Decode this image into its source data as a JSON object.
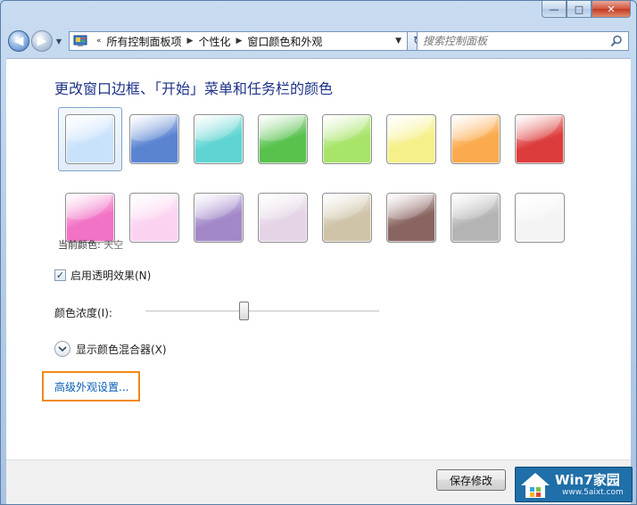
{
  "window": {
    "caption": {
      "minimize_glyph": "—",
      "maximize_glyph": "□",
      "close_glyph": "✕"
    }
  },
  "navbar": {
    "back_glyph": "◀",
    "forward_glyph": "▶",
    "history_glyph": "▼",
    "address": {
      "root_glyph": "«",
      "crumbs": [
        "所有控制面板项",
        "个性化",
        "窗口颜色和外观"
      ],
      "sep_glyph": "▶",
      "drop_glyph": "▼"
    },
    "refresh_glyph": "↻",
    "search_placeholder": "搜索控制面板"
  },
  "main": {
    "title": "更改窗口边框、「开始」菜单和任务栏的颜色",
    "swatches": [
      {
        "name": "sky",
        "color": "#c9e2fb",
        "selected": true
      },
      {
        "name": "twilight",
        "color": "#5a84d1",
        "selected": false
      },
      {
        "name": "sea",
        "color": "#5fd4d2",
        "selected": false
      },
      {
        "name": "leaf",
        "color": "#58c24d",
        "selected": false
      },
      {
        "name": "lime",
        "color": "#a8e46a",
        "selected": false
      },
      {
        "name": "lemon",
        "color": "#f6f08a",
        "selected": false
      },
      {
        "name": "pumpkin",
        "color": "#fbaa4d",
        "selected": false
      },
      {
        "name": "ruby",
        "color": "#dd3c3c",
        "selected": false
      },
      {
        "name": "fuchsia",
        "color": "#f272c6",
        "selected": false
      },
      {
        "name": "blush",
        "color": "#fbd3f1",
        "selected": false
      },
      {
        "name": "violet",
        "color": "#a288c9",
        "selected": false
      },
      {
        "name": "lavender",
        "color": "#e4d4e6",
        "selected": false
      },
      {
        "name": "taupe",
        "color": "#cfc3a8",
        "selected": false
      },
      {
        "name": "chocolate",
        "color": "#8a6460",
        "selected": false
      },
      {
        "name": "slate",
        "color": "#b4b4b4",
        "selected": false
      },
      {
        "name": "frost",
        "color": "#f4f4f4",
        "selected": false
      }
    ],
    "current_color_label": "当前颜色: ",
    "current_color_value": "天空",
    "transparency": {
      "label": "启用透明效果(N)",
      "checked": true,
      "check_glyph": "✓"
    },
    "intensity": {
      "label": "颜色浓度(I):",
      "level": 0.42
    },
    "mixer_label": "显示颜色混合器(X)",
    "advanced_link": "高级外观设置..."
  },
  "footer": {
    "save_label": "保存修改"
  },
  "watermark": {
    "title": "Win7家园",
    "url": "www.5aixt.com"
  }
}
